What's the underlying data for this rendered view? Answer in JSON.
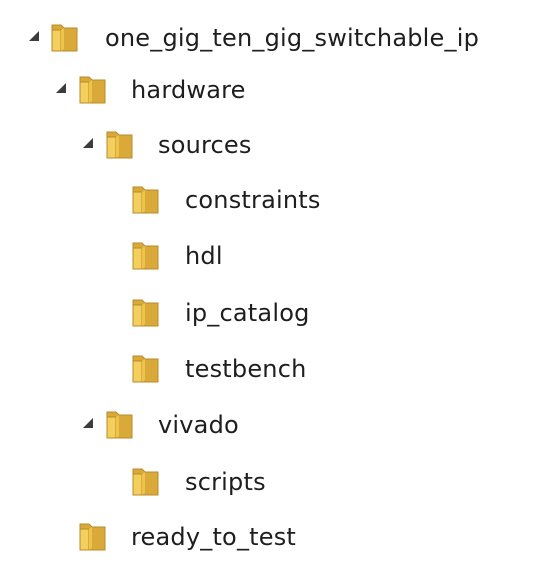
{
  "tree": {
    "items": [
      {
        "label": "one_gig_ten_gig_switchable_ip",
        "level": 0,
        "expanded": true
      },
      {
        "label": "hardware",
        "level": 1,
        "expanded": true
      },
      {
        "label": "sources",
        "level": 2,
        "expanded": true
      },
      {
        "label": "constraints",
        "level": 3,
        "expanded": null
      },
      {
        "label": "hdl",
        "level": 3,
        "expanded": null
      },
      {
        "label": "ip_catalog",
        "level": 3,
        "expanded": null
      },
      {
        "label": "testbench",
        "level": 3,
        "expanded": null
      },
      {
        "label": "vivado",
        "level": 2,
        "expanded": true
      },
      {
        "label": "scripts",
        "level": 3,
        "expanded": null
      },
      {
        "label": "ready_to_test",
        "level": 1,
        "expanded": null
      }
    ]
  },
  "icons": {
    "folder": "folder-icon",
    "expanded_arrow": "expanded-arrow-icon"
  },
  "colors": {
    "folder_front": "#f3cf5d",
    "folder_back": "#d9a93a",
    "folder_edge": "#b88a2a",
    "text": "#1e1e1e",
    "arrow": "#3c3c3c"
  }
}
